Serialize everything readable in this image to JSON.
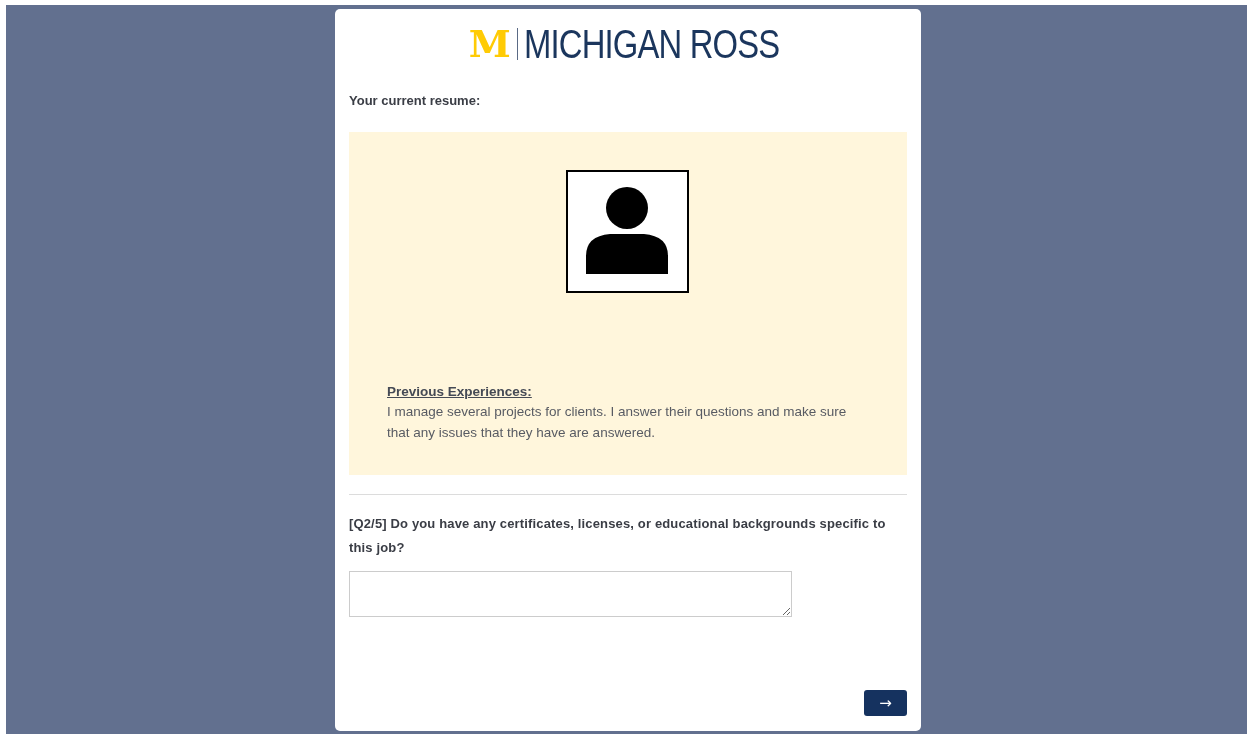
{
  "logo": {
    "mark": "M",
    "name": "MICHIGAN ROSS"
  },
  "resume": {
    "heading": "Your current resume:",
    "section_title": "Previous Experiences:",
    "section_text": "I manage several projects for clients. I answer their questions and make sure that any issues that they have are answered."
  },
  "question": {
    "label": "[Q2/5] Do you have any certificates, licenses, or educational backgrounds specific to this job?"
  },
  "next_button": {
    "label": "→"
  }
}
